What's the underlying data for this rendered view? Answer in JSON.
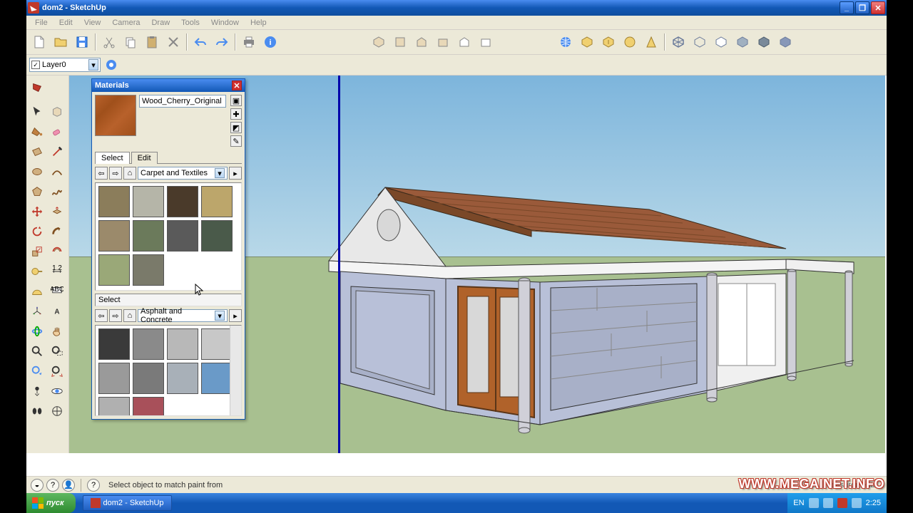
{
  "window": {
    "title": "dom2 - SketchUp",
    "minimize": "_",
    "maximize": "❐",
    "close": "✕"
  },
  "menu": {
    "file": "File",
    "edit": "Edit",
    "view": "View",
    "camera": "Camera",
    "draw": "Draw",
    "tools": "Tools",
    "window": "Window",
    "help": "Help"
  },
  "layer": {
    "name": "Layer0"
  },
  "materials": {
    "title": "Materials",
    "close": "✕",
    "current_name": "Wood_Cherry_Original",
    "tab_select": "Select",
    "tab_edit": "Edit",
    "back": "⇦",
    "fwd": "⇨",
    "home": "⌂",
    "details": "▸",
    "category1": "Carpet and Textiles",
    "section2_label": "Select",
    "category2": "Asphalt and Concrete"
  },
  "status": {
    "hint": "Select object to match paint from",
    "measurements_label": "Measurements"
  },
  "taskbar": {
    "start": "пуск",
    "task1": "dom2 - SketchUp",
    "lang": "EN",
    "time": "2:25"
  },
  "watermark": "WWW.MEGAINET.INFO",
  "swatches1_colors": [
    "#8b7d5b",
    "#b5b5a8",
    "#4a3a2a",
    "#bca66b",
    "#9b8a6b",
    "#6b7a5b",
    "#5a5a5a",
    "#4a5a4a",
    "#9aa878",
    "#7a7a6a"
  ],
  "swatches2_colors": [
    "#3a3a3a",
    "#8a8a8a",
    "#b8b8b8",
    "#c8c8c8",
    "#9a9a9a",
    "#7a7a7a",
    "#a8b0b8",
    "#6a9ac8",
    "#b0b0b0",
    "#a8505a"
  ]
}
